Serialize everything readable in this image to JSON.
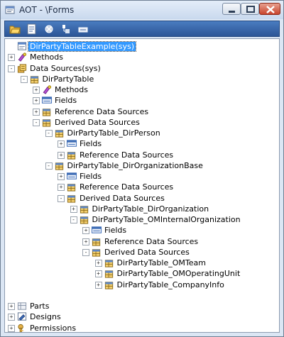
{
  "window": {
    "title": "AOT - \\Forms"
  },
  "toolbar": {
    "buttons": [
      {
        "icon": "open-folder-icon"
      },
      {
        "icon": "properties-icon"
      },
      {
        "icon": "compile-icon"
      },
      {
        "icon": "lookup-icon"
      },
      {
        "icon": "run-icon"
      }
    ]
  },
  "tree": {
    "nodes": [
      {
        "label": "DirPartyTableExample(sys)",
        "level": 0,
        "expander": "",
        "icon": "form-icon",
        "selected": true
      },
      {
        "label": "Methods",
        "level": 0,
        "expander": "+",
        "icon": "methods-icon"
      },
      {
        "label": "Data Sources(sys)",
        "level": 0,
        "expander": "-",
        "icon": "datasources-icon"
      },
      {
        "label": "DirPartyTable",
        "level": 1,
        "expander": "-",
        "icon": "datasource-icon"
      },
      {
        "label": "Methods",
        "level": 2,
        "expander": "+",
        "icon": "methods-icon"
      },
      {
        "label": "Fields",
        "level": 2,
        "expander": "+",
        "icon": "fields-icon"
      },
      {
        "label": "Reference Data Sources",
        "level": 2,
        "expander": "+",
        "icon": "datasource-icon"
      },
      {
        "label": "Derived Data Sources",
        "level": 2,
        "expander": "-",
        "icon": "datasource-icon"
      },
      {
        "label": "DirPartyTable_DirPerson",
        "level": 3,
        "expander": "-",
        "icon": "datasource-icon"
      },
      {
        "label": "Fields",
        "level": 4,
        "expander": "+",
        "icon": "fields-icon"
      },
      {
        "label": "Reference Data Sources",
        "level": 4,
        "expander": "+",
        "icon": "datasource-icon"
      },
      {
        "label": "DirPartyTable_DirOrganizationBase",
        "level": 3,
        "expander": "-",
        "icon": "datasource-icon"
      },
      {
        "label": "Fields",
        "level": 4,
        "expander": "+",
        "icon": "fields-icon"
      },
      {
        "label": "Reference Data Sources",
        "level": 4,
        "expander": "+",
        "icon": "datasource-icon"
      },
      {
        "label": "Derived Data Sources",
        "level": 4,
        "expander": "-",
        "icon": "datasource-icon"
      },
      {
        "label": "DirPartyTable_DirOrganization",
        "level": 5,
        "expander": "+",
        "icon": "datasource-icon"
      },
      {
        "label": "DirPartyTable_OMInternalOrganization",
        "level": 5,
        "expander": "-",
        "icon": "datasource-icon"
      },
      {
        "label": "Fields",
        "level": 6,
        "expander": "+",
        "icon": "fields-icon"
      },
      {
        "label": "Reference Data Sources",
        "level": 6,
        "expander": "+",
        "icon": "datasource-icon"
      },
      {
        "label": "Derived Data Sources",
        "level": 6,
        "expander": "-",
        "icon": "datasource-icon"
      },
      {
        "label": "DirPartyTable_OMTeam",
        "level": 7,
        "expander": "+",
        "icon": "datasource-icon"
      },
      {
        "label": "DirPartyTable_OMOperatingUnit",
        "level": 7,
        "expander": "+",
        "icon": "datasource-icon"
      },
      {
        "label": "DirPartyTable_CompanyInfo",
        "level": 7,
        "expander": "+",
        "icon": "datasource-icon"
      },
      {
        "label": "",
        "level": 0,
        "expander": "",
        "icon": ""
      },
      {
        "label": "Parts",
        "level": 0,
        "expander": "+",
        "icon": "parts-icon"
      },
      {
        "label": "Designs",
        "level": 0,
        "expander": "+",
        "icon": "designs-icon"
      },
      {
        "label": "Permissions",
        "level": 0,
        "expander": "+",
        "icon": "permissions-icon"
      }
    ]
  }
}
